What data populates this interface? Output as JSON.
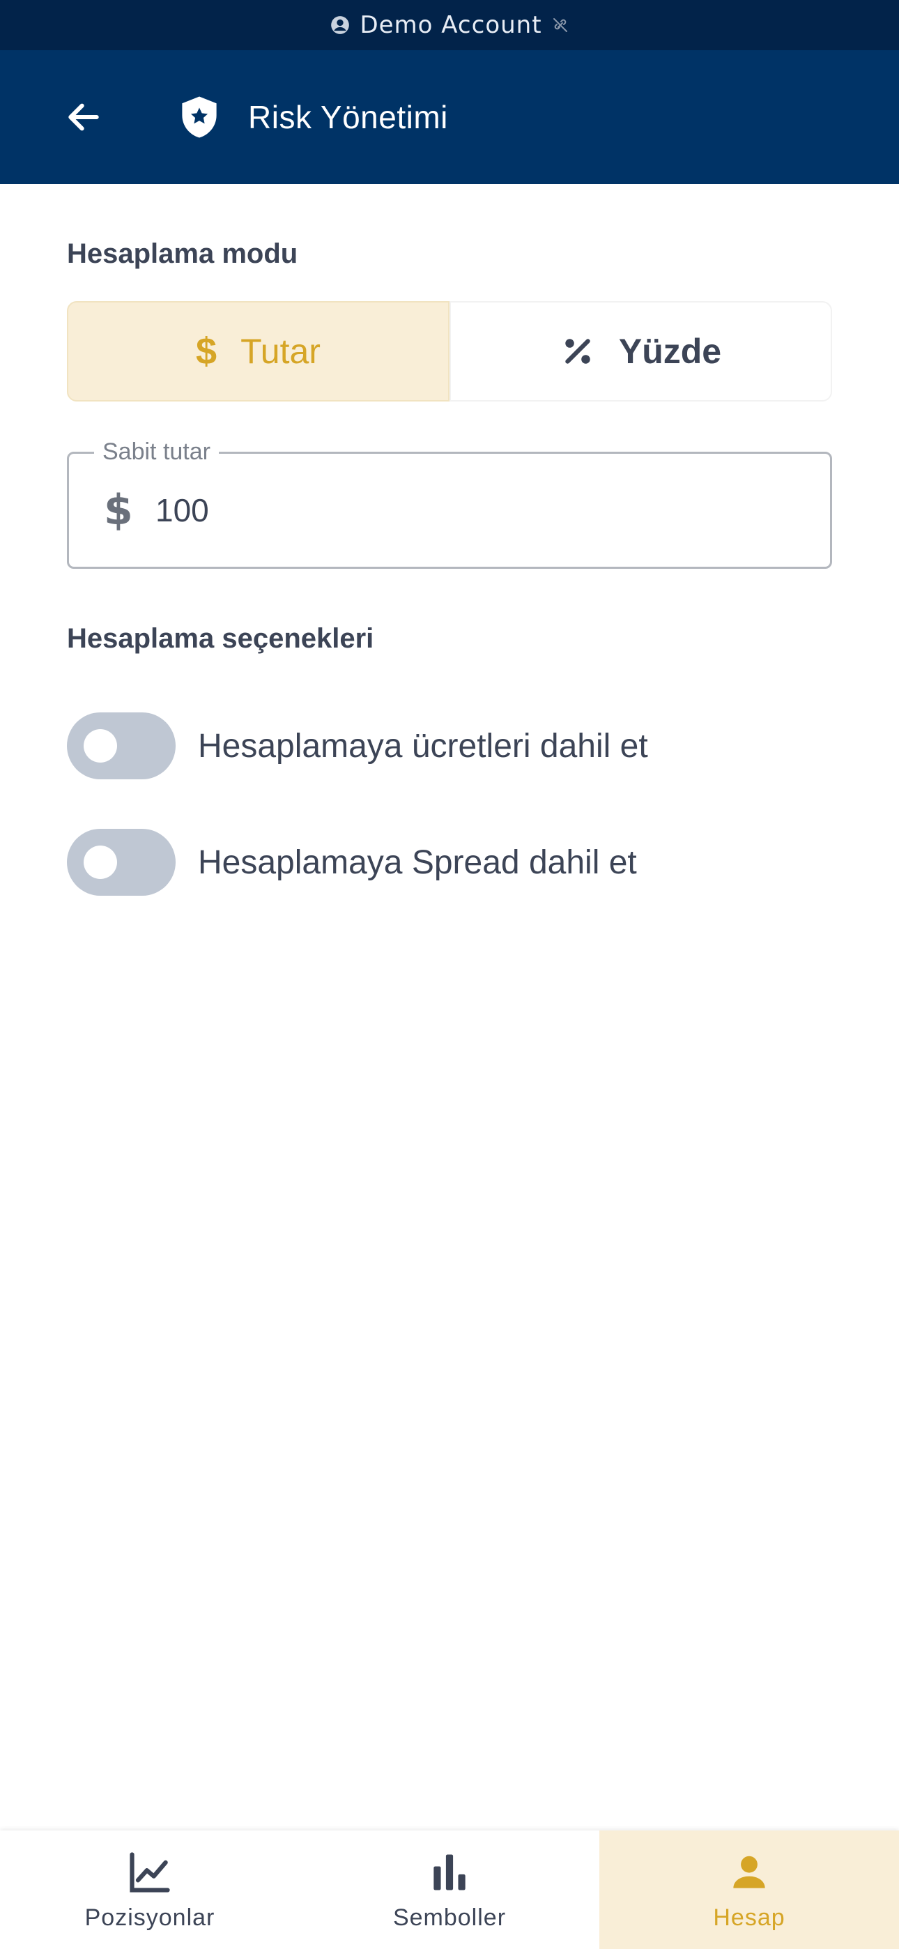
{
  "status_bar": {
    "account_label": "Demo Account",
    "account_icon": "account-circle-icon",
    "connection_icon": "link-off-icon"
  },
  "app_bar": {
    "title": "Risk Yönetimi",
    "back_icon": "arrow-left-icon",
    "title_icon": "shield-star-icon"
  },
  "calc_mode": {
    "section_label": "Hesaplama modu",
    "options": [
      {
        "label": "Tutar",
        "icon": "dollar-icon",
        "selected": true
      },
      {
        "label": "Yüzde",
        "icon": "percent-icon",
        "selected": false
      }
    ]
  },
  "fixed_amount": {
    "label": "Sabit tutar",
    "prefix": "$",
    "value": "100"
  },
  "calc_options": {
    "section_label": "Hesaplama seçenekleri",
    "toggles": [
      {
        "label": "Hesaplamaya ücretleri dahil et",
        "on": false
      },
      {
        "label": "Hesaplamaya Spread dahil et",
        "on": false
      }
    ]
  },
  "bottom_nav": {
    "items": [
      {
        "label": "Pozisyonlar",
        "icon": "line-chart-icon",
        "active": false
      },
      {
        "label": "Semboller",
        "icon": "bar-chart-icon",
        "active": false
      },
      {
        "label": "Hesap",
        "icon": "person-icon",
        "active": true
      }
    ]
  },
  "colors": {
    "status_bar_bg": "#02234a",
    "app_bar_bg": "#003366",
    "accent": "#d6a526",
    "accent_bg": "#f9eed7",
    "switch_off": "#bfc7d3"
  }
}
